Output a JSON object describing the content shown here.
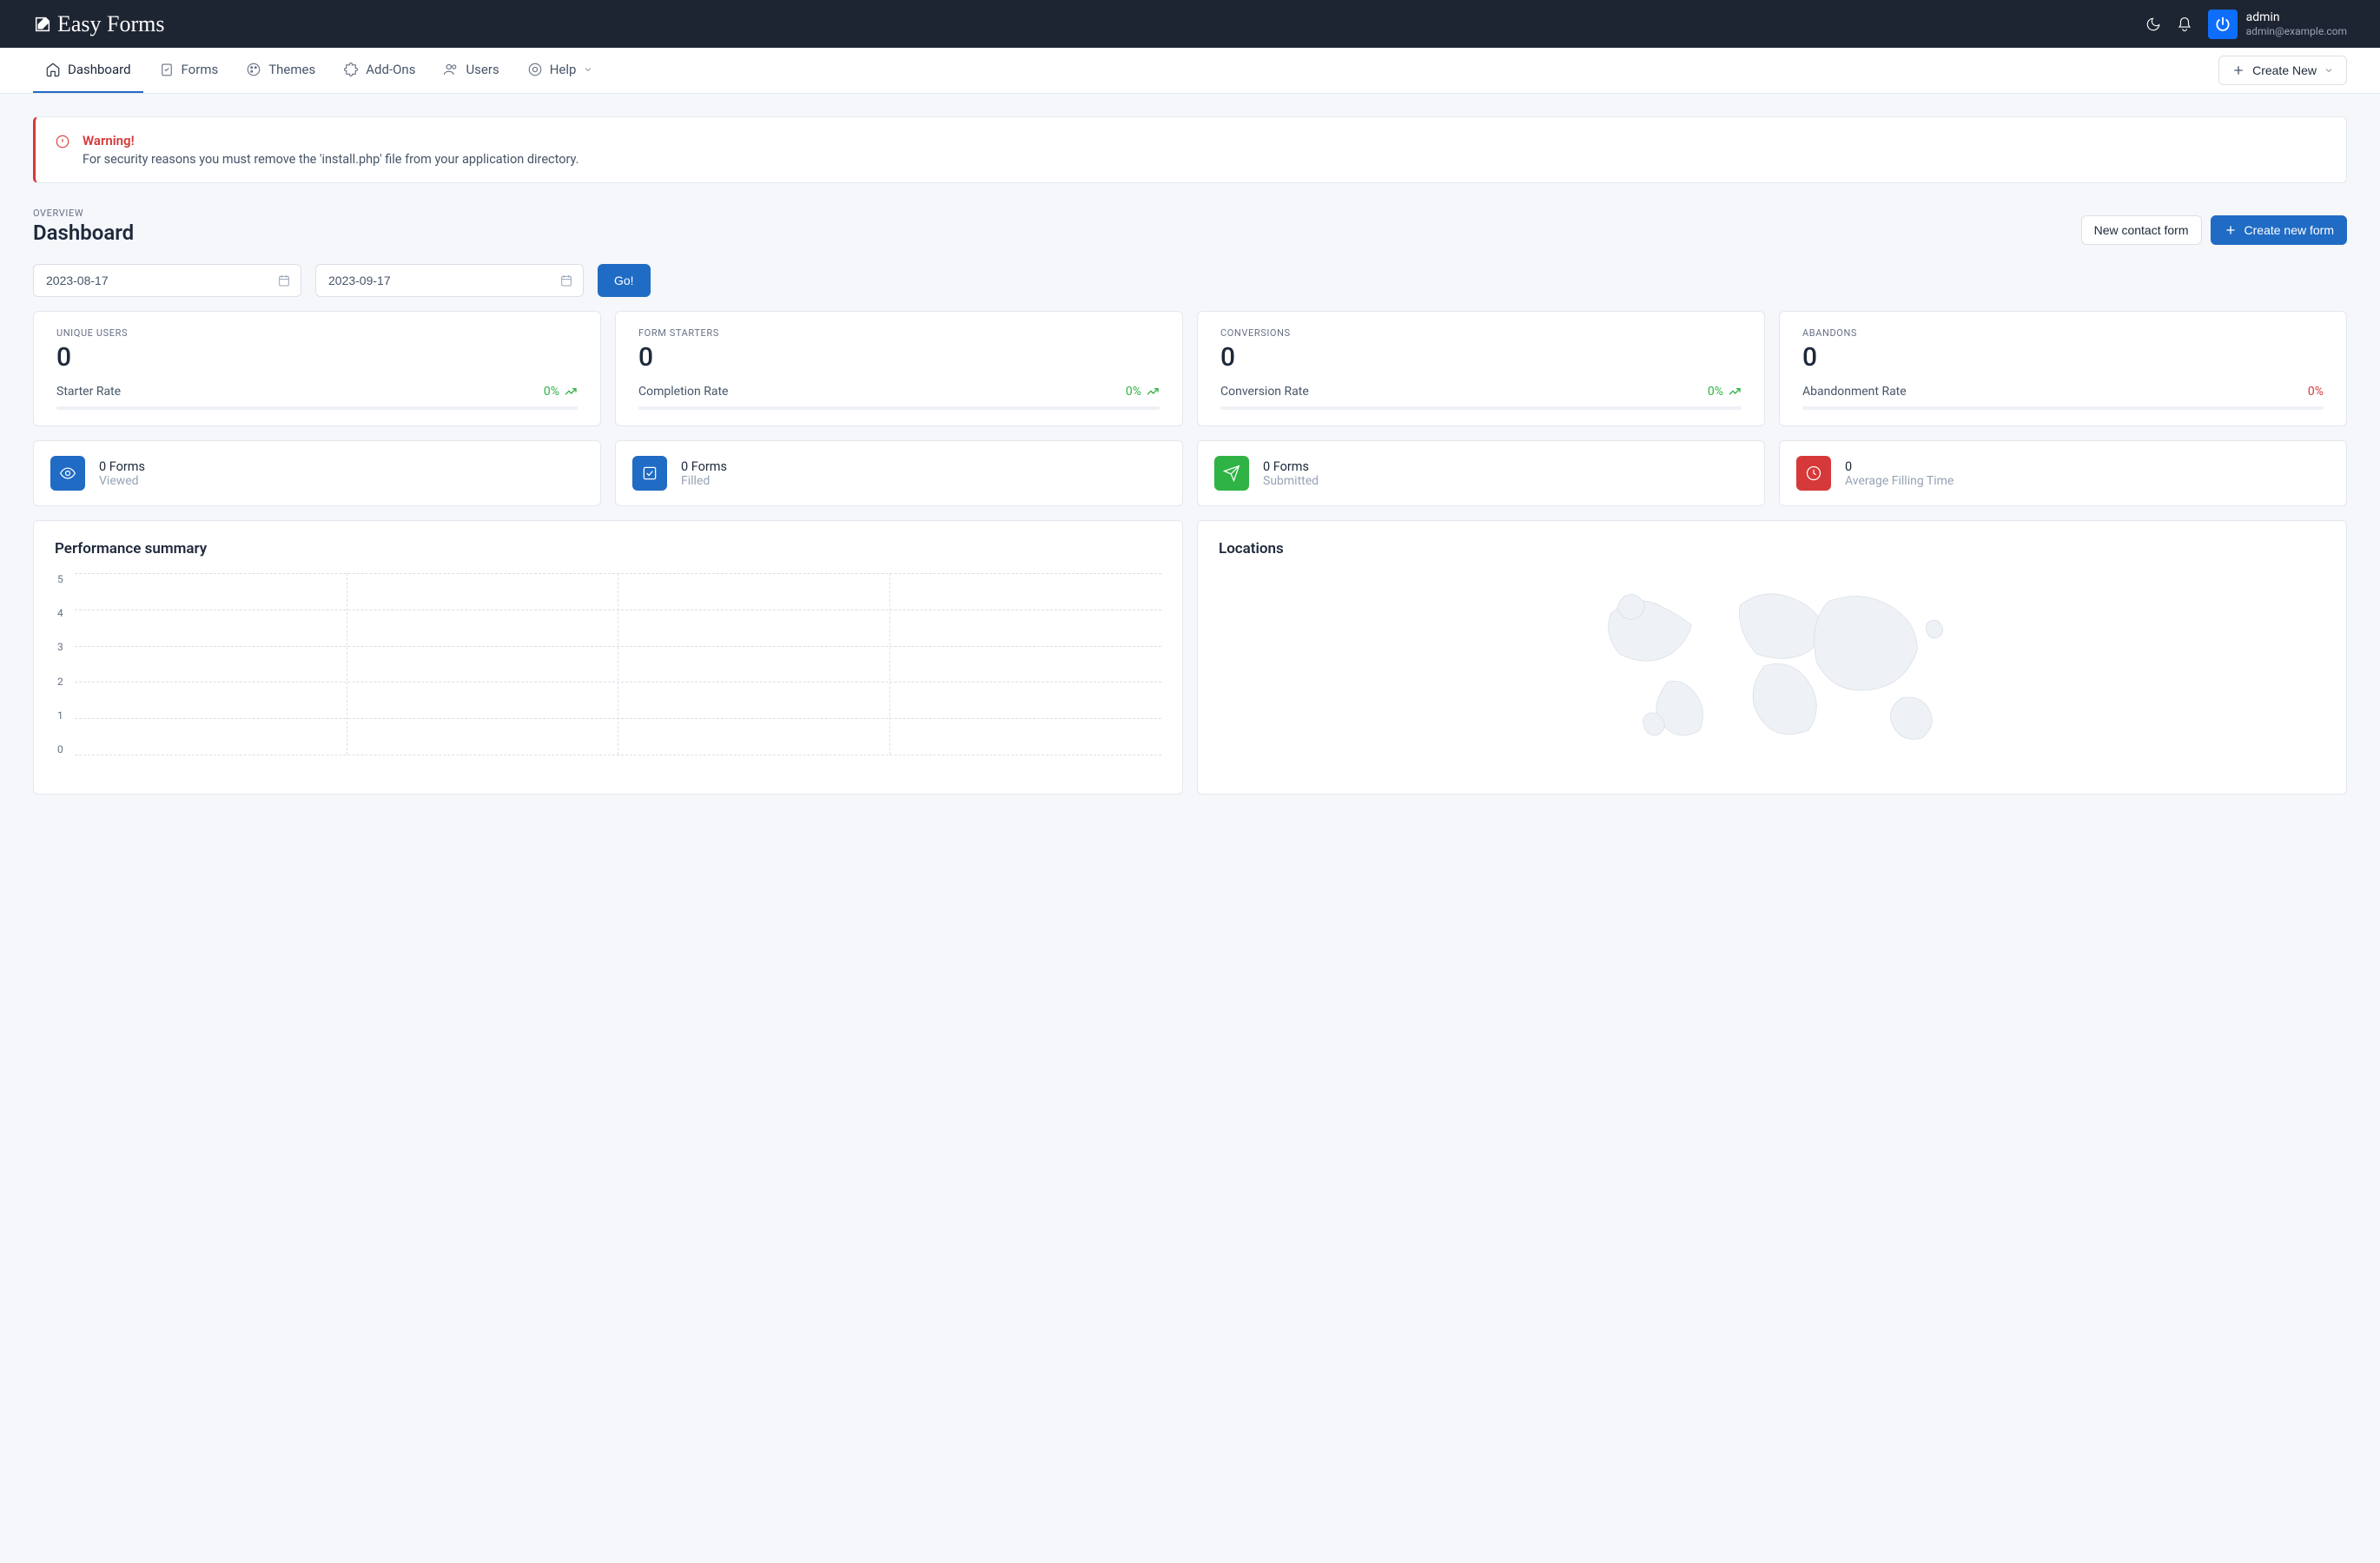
{
  "header": {
    "logo_text": "Easy Forms",
    "user_name": "admin",
    "user_email": "admin@example.com"
  },
  "nav": {
    "dashboard": "Dashboard",
    "forms": "Forms",
    "themes": "Themes",
    "addons": "Add-Ons",
    "users": "Users",
    "help": "Help",
    "create_new": "Create New"
  },
  "alert": {
    "title": "Warning!",
    "body": "For security reasons you must remove the 'install.php' file from your application directory."
  },
  "page": {
    "overview_label": "OVERVIEW",
    "title": "Dashboard",
    "new_contact_btn": "New contact form",
    "create_form_btn": "Create new form"
  },
  "dates": {
    "from": "2023-08-17",
    "to": "2023-09-17",
    "go": "Go!"
  },
  "stats": {
    "unique_users": {
      "label": "UNIQUE USERS",
      "value": "0",
      "rate_label": "Starter Rate",
      "pct": "0%"
    },
    "form_starters": {
      "label": "FORM STARTERS",
      "value": "0",
      "rate_label": "Completion Rate",
      "pct": "0%"
    },
    "conversions": {
      "label": "CONVERSIONS",
      "value": "0",
      "rate_label": "Conversion Rate",
      "pct": "0%"
    },
    "abandons": {
      "label": "ABANDONS",
      "value": "0",
      "rate_label": "Abandonment Rate",
      "pct": "0%"
    }
  },
  "mini": {
    "viewed": {
      "title": "0 Forms",
      "sub": "Viewed"
    },
    "filled": {
      "title": "0 Forms",
      "sub": "Filled"
    },
    "submitted": {
      "title": "0 Forms",
      "sub": "Submitted"
    },
    "avg_time": {
      "title": "0",
      "sub": "Average Filling Time"
    }
  },
  "panels": {
    "performance_title": "Performance summary",
    "locations_title": "Locations"
  },
  "chart_data": {
    "type": "line",
    "title": "Performance summary",
    "xlabel": "",
    "ylabel": "",
    "ylim": [
      0,
      5
    ],
    "y_ticks": [
      5,
      4,
      3,
      2,
      1,
      0
    ],
    "series": []
  }
}
